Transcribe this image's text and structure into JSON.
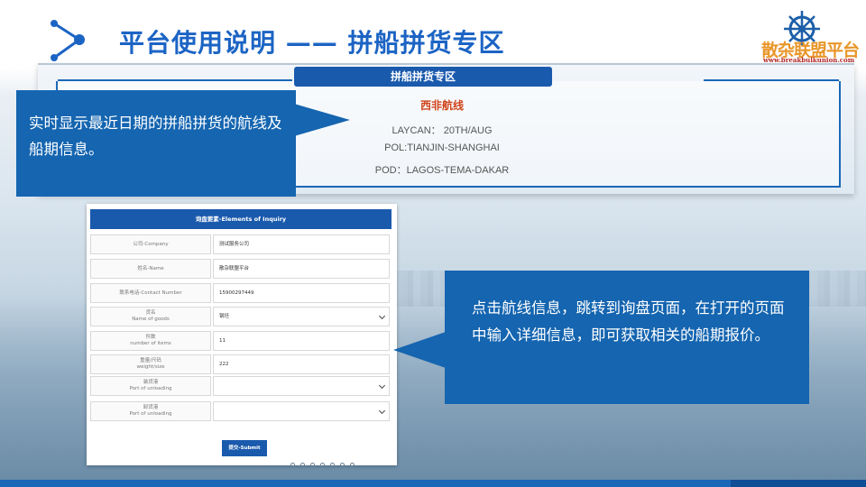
{
  "header": {
    "title": "平台使用说明 —— 拼船拼货专区",
    "logo_text": "散杂联盟平台",
    "logo_url": "www.breakbulkunion.com"
  },
  "route_panel": {
    "banner": "拼船拼货专区",
    "route_name": "西非航线",
    "laycan": "LAYCAN： 20TH/AUG",
    "pol": "POL:TIANJIN-SHANGHAI",
    "pod": "POD：LAGOS-TEMA-DAKAR"
  },
  "callouts": {
    "first": "实时显示最近日期的拼船拼货的航线及船期信息。",
    "second": "点击航线信息，跳转到询盘页面，在打开的页面中输入详细信息，即可获取相关的船期报价。"
  },
  "form": {
    "title": "询盘要素-Elements of Inquiry",
    "rows": [
      {
        "label_cn": "公司-Company",
        "label_en": "",
        "value": "测试服务公司",
        "type": "text"
      },
      {
        "label_cn": "姓名-Name",
        "label_en": "",
        "value": "散杂联盟平台",
        "type": "text"
      },
      {
        "label_cn": "联系电话-Contact Number",
        "label_en": "",
        "value": "15900297449",
        "type": "text"
      },
      {
        "label_cn": "货名",
        "label_en": "Name of goods",
        "value": "钢坯",
        "type": "select"
      },
      {
        "label_cn": "件数",
        "label_en": "number of items",
        "value": "11",
        "type": "text"
      },
      {
        "label_cn": "重量/尺码",
        "label_en": "weight/size",
        "value": "222",
        "type": "text"
      },
      {
        "label_cn": "装货港",
        "label_en": "Port of unloading",
        "value": "",
        "type": "select"
      },
      {
        "label_cn": "卸货港",
        "label_en": "Port of unloading",
        "value": "",
        "type": "select"
      }
    ],
    "submit_label": "提交-Submit"
  },
  "colors": {
    "primary_blue": "#1a5aad",
    "callout_blue": "#1565b0",
    "title_blue": "#1c64c4",
    "route_red": "#d0441c",
    "logo_orange": "#e8962a"
  }
}
